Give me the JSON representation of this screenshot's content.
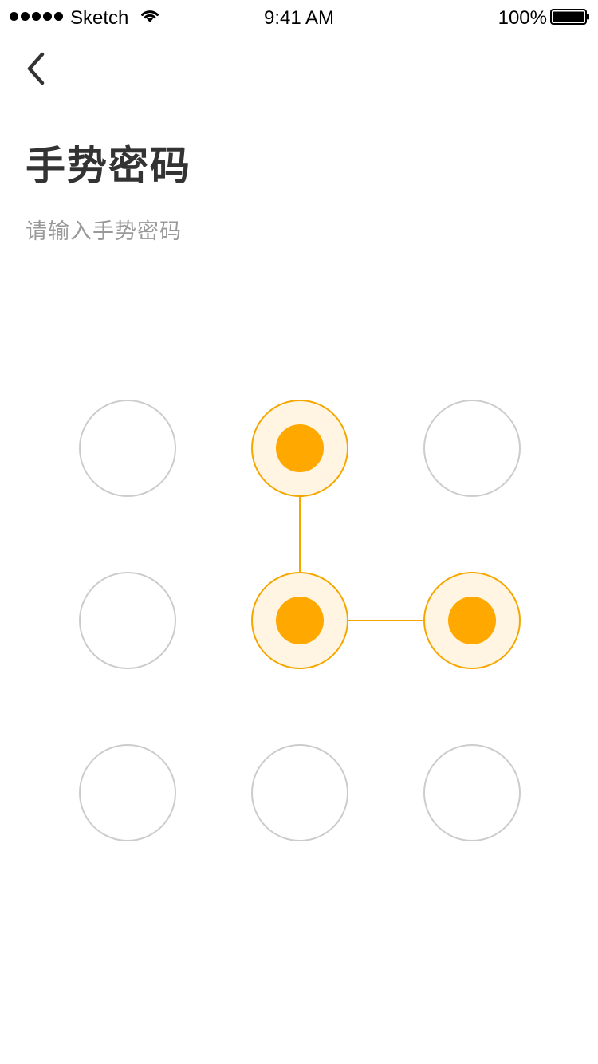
{
  "status_bar": {
    "carrier": "Sketch",
    "time": "9:41 AM",
    "battery": "100%",
    "signal_icon": "signal-dots-icon",
    "wifi_icon": "wifi-icon",
    "battery_icon": "battery-icon"
  },
  "nav": {
    "back_icon": "chevron-left-icon"
  },
  "header": {
    "title": "手势密码",
    "subtitle": "请输入手势密码"
  },
  "gesture": {
    "selected_nodes": [
      1,
      4,
      5
    ],
    "colors": {
      "active_stroke": "#F5A700",
      "active_fill": "#FFF5E2",
      "active_dot": "#FFA800",
      "inactive_stroke": "#CCCCCC",
      "line": "#F5A700"
    }
  }
}
